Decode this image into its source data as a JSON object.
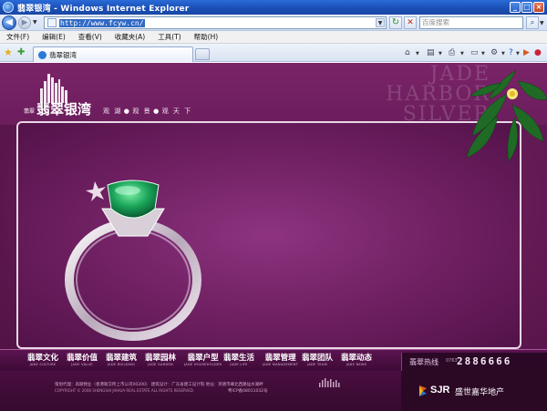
{
  "window": {
    "title": "翡翠银湾 - Windows Internet Explorer"
  },
  "address_bar": {
    "url": "http://www.fcyw.cn/",
    "search_placeholder": "百度搜索"
  },
  "menu": [
    "文件(F)",
    "编辑(E)",
    "查看(V)",
    "收藏夹(A)",
    "工具(T)",
    "帮助(H)"
  ],
  "tab": {
    "label": "翡翠银湾"
  },
  "site": {
    "bg_words": [
      "JADE",
      "HARBOR",
      "SILVER"
    ],
    "logo_small": "翡翠",
    "logo_main": "翡翠银湾",
    "slogan": [
      "观 湖",
      "观 景",
      "观 天 下"
    ],
    "nav": [
      {
        "zh": "翡翠文化",
        "en": "JADE CULTURE"
      },
      {
        "zh": "翡翠价值",
        "en": "JADE VALUE"
      },
      {
        "zh": "翡翠建筑",
        "en": "JADE BUILDING"
      },
      {
        "zh": "翡翠园林",
        "en": "JADE GARDEN"
      },
      {
        "zh": "翡翠户型",
        "en": "JADE HOUSEHOLDER"
      },
      {
        "zh": "翡翠生活",
        "en": "JADE LIFE"
      },
      {
        "zh": "翡翠管理",
        "en": "JADE MANAGEMENT"
      },
      {
        "zh": "翡翠团队",
        "en": "JADE TEAM"
      },
      {
        "zh": "翡翠动态",
        "en": "JADE NEWS"
      }
    ],
    "hotline_label": "翡翠热线",
    "hotline_area": "0763",
    "hotline_number": "2886666",
    "footer_line1": "策划代理：高联物业（香港联交所上市公司00200）   建筑设计：广东省建工设计院   地址：英德市峰北西路仙水湖畔",
    "footer_line2": "COPYRIGHT © 2008 SHENGSHI JIAHUA REAL ESTATE ALL RIGHTS RESERVED.",
    "footer_icp": "粤ICP备08011032号",
    "brand_short": "SJR",
    "brand_cn": "盛世嘉华地产"
  }
}
